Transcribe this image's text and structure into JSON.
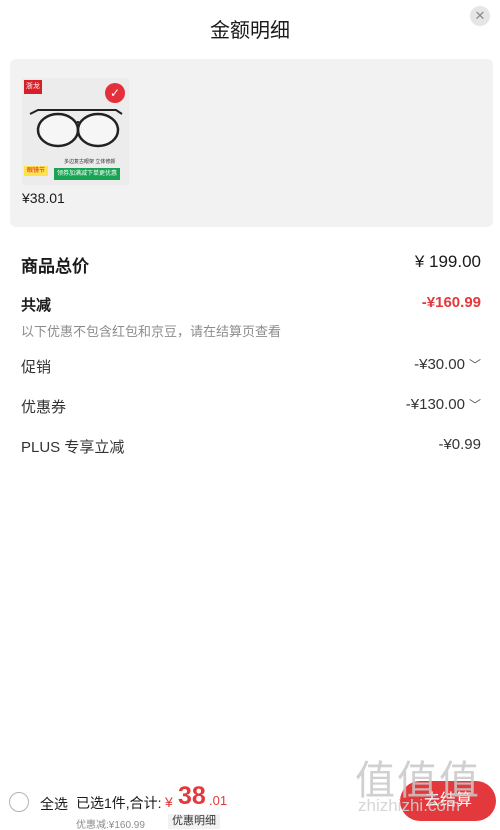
{
  "header": {
    "title": "金额明细",
    "close_icon": "close-icon"
  },
  "product": {
    "price": "¥38.01",
    "brand_tag": "浙龙",
    "promo_line": "多边复古眼架 立体修颜",
    "promo_badge": "眼镜节",
    "promo_banner": "领券加满减下单更优惠",
    "check_icon": "check-icon"
  },
  "summary": {
    "total_label": "商品总价",
    "total_value": "¥ 199.00",
    "reduce_label": "共减",
    "reduce_value": "-¥160.99",
    "note": "以下优惠不包含红包和京豆，请在结算页查看",
    "promo_label": "促销",
    "promo_value": "-¥30.00",
    "coupon_label": "优惠券",
    "coupon_value": "-¥130.00",
    "plus_label": "PLUS 专享立减",
    "plus_value": "-¥0.99"
  },
  "footer": {
    "select_all": "全选",
    "selected_info": "已选1件,合计:",
    "sum_currency": "¥",
    "sum_int": "38",
    "sum_dec": ".01",
    "discount_info": "优惠减:¥160.99",
    "detail_button": "优惠明细",
    "checkout_button": "去结算"
  },
  "watermark": {
    "logo": "值值值",
    "text": "zhizhizhi.com"
  },
  "colors": {
    "accent_red": "#e4393c",
    "muted_text": "#8c8c8c"
  }
}
